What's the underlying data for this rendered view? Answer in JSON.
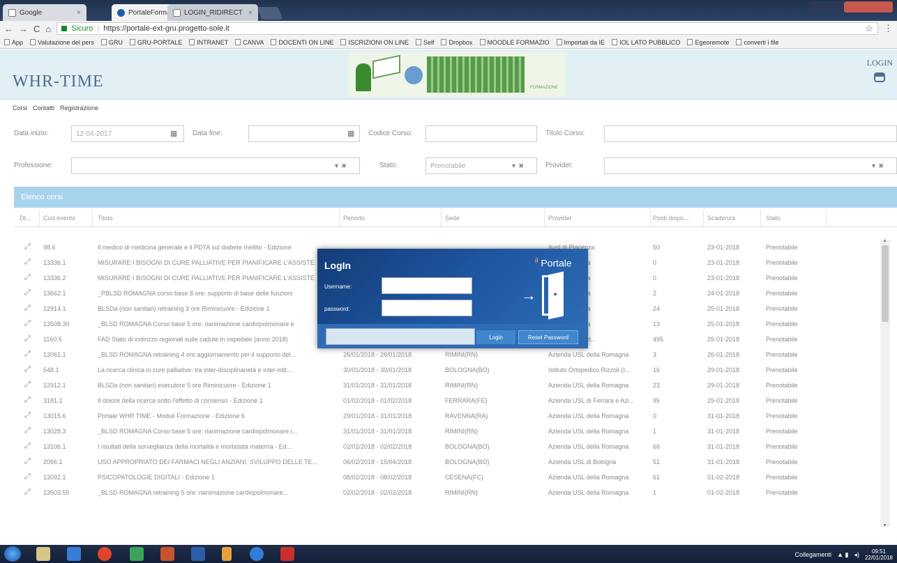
{
  "browser": {
    "tabs": [
      {
        "label": "Google"
      },
      {
        "label": "PortaleFormazioneRER"
      },
      {
        "label": "LOGIN_RIDIRECT"
      }
    ],
    "secure_label": "Sicuro",
    "url": "https://portale-ext-gru.progetto-sole.it",
    "bookmarks": [
      "App",
      "Valutazione del pers",
      "GRU",
      "GRU-PORTALE",
      "INTRANET",
      "CANVA",
      "DOCENTI ON LINE",
      "ISCRIZIONI ON LINE",
      "Self",
      "Dropbox",
      "MOODLE FORMAZIO",
      "Importati da IE",
      "IOL LATO PUBBLICO",
      "Egeoremote",
      "converti i file"
    ]
  },
  "header": {
    "logo": "WHR-TIME",
    "login_label": "LOGIN",
    "banner_caption": "FORMAZIONE"
  },
  "menu": [
    "Corsi",
    "Contatti",
    "Registrazione"
  ],
  "filters": {
    "data_inizio_label": "Data inizio:",
    "data_inizio_value": "12-04-2017",
    "data_fine_label": "Data fine:",
    "codice_label": "Codice Corso:",
    "titolo_label": "Titolo Corso:",
    "professione_label": "Professione:",
    "stato_label": "Stato:",
    "stato_value": "Prenotabile",
    "provider_label": "Provider:"
  },
  "table": {
    "title": "Elenco corsi",
    "headers": [
      "Dt...",
      "Cod.evento",
      "Titolo",
      "Periodo",
      "Sede",
      "Provider",
      "Posti dispo...",
      "Scadenza",
      "Stato"
    ],
    "rows": [
      [
        "98.6",
        "Il medico di medicina generale e il PDTA sul diabete mellito - Edizione",
        "",
        "",
        "Ausl di Piacenza",
        "50",
        "23-01-2018",
        "Prenotabile"
      ],
      [
        "13336.1",
        "MISURARE I BISOGNI DI CURE PALLIATIVE PER PIANIFICARE L'ASSISTE",
        "",
        "",
        "della Romagna",
        "0",
        "23-01-2018",
        "Prenotabile"
      ],
      [
        "13336.2",
        "MISURARE I BISOGNI DI CURE PALLIATIVE PER PIANIFICARE L'ASSISTE",
        "",
        "",
        "della Romagna",
        "0",
        "23-01-2018",
        "Prenotabile"
      ],
      [
        "13662.1",
        "_PBLSD ROMAGNA corso base 8 ore: supporto di base delle funzioni",
        "",
        "",
        "della Romagna",
        "2",
        "24-01-2018",
        "Prenotabile"
      ],
      [
        "12914.1",
        "BLSDa (non sanitari) retraining 3 ore Riminicuore - Edizione 1",
        "",
        "",
        "della Romagna",
        "24",
        "25-01-2018",
        "Prenotabile"
      ],
      [
        "13508.30",
        "_BLSD ROMAGNA Corso base 5 ore: rianimazione cardiopolmonare e",
        "",
        "",
        "della Romagna",
        "13",
        "25-01-2018",
        "Prenotabile"
      ],
      [
        "1160.5",
        "FAD Stato di indirizzo regionali sulle cadute in ospedale (anno 2018)",
        "",
        "",
        "di Ferrara e Azi...",
        "495",
        "25-01-2018",
        "Prenotabile"
      ],
      [
        "13061.1",
        "_BLSD ROMAGNA retraining 4 ore:aggiornamento per il supporto del...",
        "26/01/2018 - 26/01/2018",
        "RIMINI(RN)",
        "Azienda USL della Romagna",
        "3",
        "26-01-2018",
        "Prenotabile"
      ],
      [
        "548.1",
        "La ricerca clinica in cure palliative: tra inter-disciplinarietà e inter-istit...",
        "30/01/2018 - 30/01/2018",
        "BOLOGNA(BO)",
        "Istituto Ortopedico Rizzoli (I...",
        "16",
        "29-01-2018",
        "Prenotabile"
      ],
      [
        "12912.1",
        "BLSDa (non sanitari) esecutore 5 ore Riminicuore - Edizione 1",
        "31/01/2018 - 31/01/2018",
        "RIMINI(RN)",
        "Azienda USL della Romagna",
        "23",
        "29-01-2018",
        "Prenotabile"
      ],
      [
        "3181.1",
        "Il dolore della ricerca sotto l'effetto di consenso - Edizione 1",
        "01/02/2018 - 01/02/2018",
        "FERRARA(FE)",
        "Azienda USL di Ferrara e Azi...",
        "95",
        "29-01-2018",
        "Prenotabile"
      ],
      [
        "13015.6",
        "Portale WHR TIME - Moduli Formazione - Edizione 6",
        "29/01/2018 - 31/01/2018",
        "RAVENNA(RA)",
        "Azienda USL della Romagna",
        "0",
        "31-01-2018",
        "Prenotabile"
      ],
      [
        "13028.3",
        "_BLSD ROMAGNA Corso base 5 ore: rianimazione cardiopolmonare i...",
        "31/01/2018 - 31/01/2018",
        "RIMINI(RN)",
        "Azienda USL della Romagna",
        "1",
        "31-01-2018",
        "Prenotabile"
      ],
      [
        "13106.1",
        "I risultati della sorveglianza della mortalità e morbosità materna - Ed...",
        "02/02/2018 - 02/02/2018",
        "BOLOGNA(BO)",
        "Azienda USL della Romagna",
        "66",
        "31-01-2018",
        "Prenotabile"
      ],
      [
        "2066.1",
        "USO APPROPRIATO DEI FARMACI NEGLI ANZIANI: SVILUPPO DELLE TE...",
        "06/02/2018 - 15/04/2018",
        "BOLOGNA(BO)",
        "Azienda USL di Bologna",
        "51",
        "31-01-2018",
        "Prenotabile"
      ],
      [
        "13092.1",
        "PSICOPATOLOGIE DIGITALI - Edizione 1",
        "08/02/2018 - 08/02/2018",
        "CESENA(FC)",
        "Azienda USL della Romagna",
        "61",
        "01-02-2018",
        "Prenotabile"
      ],
      [
        "13503.55",
        "_BLSD ROMAGNA retraining 5 ore: rianimazione cardiopolmonare...",
        "02/02/2018 - 02/02/2018",
        "RIMINI(RN)",
        "Azienda USL della Romagna",
        "1",
        "01-02-2018",
        "Prenotabile"
      ]
    ]
  },
  "modal": {
    "title": "LogIn",
    "brand_prefix": "il",
    "brand": "Portale",
    "username_label": "Username:",
    "password_label": "password:",
    "login_button": "Login",
    "reset_button": "Reset Password"
  },
  "taskbar": {
    "network_label": "Collegamenti",
    "time": "09:51",
    "date": "22/01/2018"
  }
}
